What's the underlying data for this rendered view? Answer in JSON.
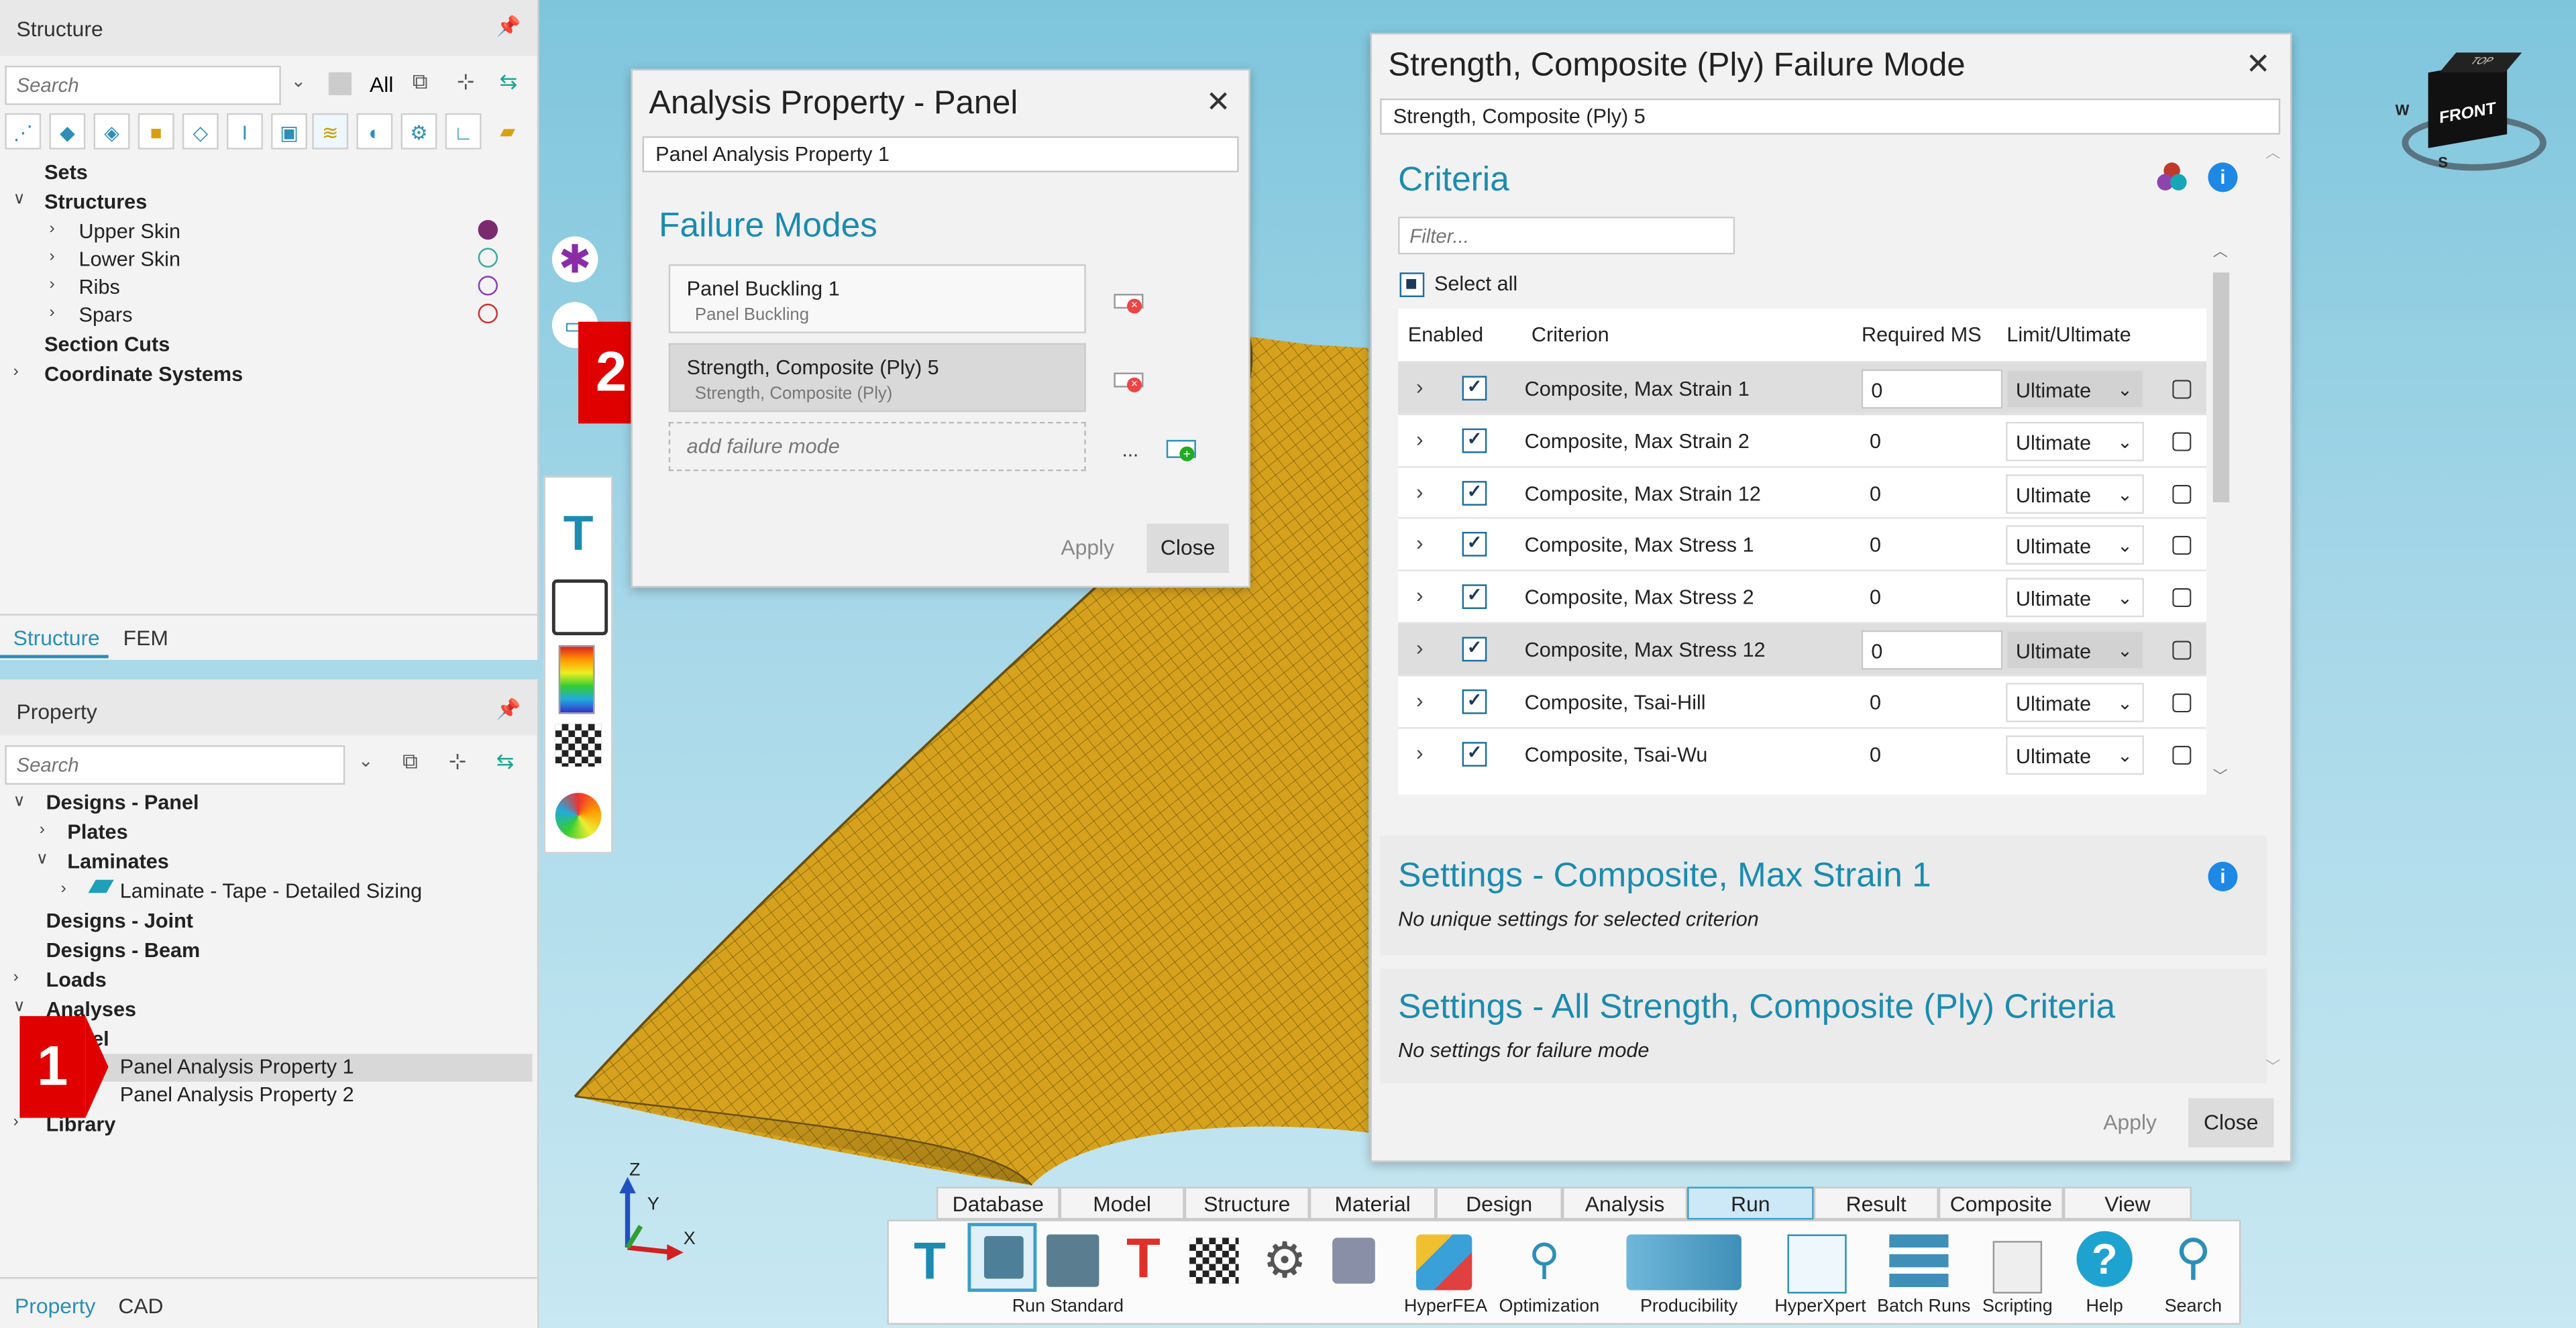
{
  "structure_panel": {
    "title": "Structure",
    "search_placeholder": "Search",
    "filter_label": "All",
    "tree": [
      {
        "label": "Sets"
      },
      {
        "label": "Structures"
      },
      {
        "label": "Upper Skin",
        "color": "#7b2a70"
      },
      {
        "label": "Lower Skin",
        "color": "#3aa9a0"
      },
      {
        "label": "Ribs",
        "color": "#8a3cc0"
      },
      {
        "label": "Spars",
        "color": "#d03030"
      },
      {
        "label": "Section Cuts"
      },
      {
        "label": "Coordinate Systems"
      }
    ],
    "tabs": [
      "Structure",
      "FEM"
    ]
  },
  "property_panel": {
    "title": "Property",
    "search_placeholder": "Search",
    "tree": [
      {
        "label": "Designs - Panel"
      },
      {
        "label": "Plates"
      },
      {
        "label": "Laminates"
      },
      {
        "label": "Laminate - Tape - Detailed Sizing"
      },
      {
        "label": "Designs - Joint"
      },
      {
        "label": "Designs - Beam"
      },
      {
        "label": "Loads"
      },
      {
        "label": "Analyses"
      },
      {
        "label": "el"
      },
      {
        "label": "Panel Analysis Property 1"
      },
      {
        "label": "Panel Analysis Property 2"
      },
      {
        "label": "Library"
      }
    ],
    "tabs": [
      "Property",
      "CAD"
    ]
  },
  "analysis_dialog": {
    "title": "Analysis Property - Panel",
    "name_value": "Panel Analysis Property 1",
    "section_title": "Failure Modes",
    "modes": [
      {
        "name": "Panel Buckling 1",
        "type": "Panel Buckling"
      },
      {
        "name": "Strength, Composite (Ply) 5",
        "type": "Strength, Composite (Ply)"
      }
    ],
    "add_placeholder": "add failure mode",
    "ellipsis": "...",
    "apply": "Apply",
    "close": "Close"
  },
  "failure_dialog": {
    "title": "Strength, Composite (Ply) Failure Mode",
    "name_value": "Strength, Composite (Ply) 5",
    "criteria_title": "Criteria",
    "filter_placeholder": "Filter...",
    "select_all": "Select all",
    "columns": [
      "Enabled",
      "Criterion",
      "Required MS",
      "Limit/Ultimate"
    ],
    "rows": [
      {
        "criterion": "Composite, Max Strain 1",
        "ms": "0",
        "limit": "Ultimate"
      },
      {
        "criterion": "Composite, Max Strain 2",
        "ms": "0",
        "limit": "Ultimate"
      },
      {
        "criterion": "Composite, Max Strain 12",
        "ms": "0",
        "limit": "Ultimate"
      },
      {
        "criterion": "Composite, Max Stress 1",
        "ms": "0",
        "limit": "Ultimate"
      },
      {
        "criterion": "Composite, Max Stress 2",
        "ms": "0",
        "limit": "Ultimate"
      },
      {
        "criterion": "Composite, Max Stress 12",
        "ms": "0",
        "limit": "Ultimate"
      },
      {
        "criterion": "Composite, Tsai-Hill",
        "ms": "0",
        "limit": "Ultimate"
      },
      {
        "criterion": "Composite, Tsai-Wu",
        "ms": "0",
        "limit": "Ultimate"
      }
    ],
    "settings1_title": "Settings - Composite, Max Strain 1",
    "settings1_text": "No unique settings for selected criterion",
    "settings2_title": "Settings - All Strength, Composite (Ply) Criteria",
    "settings2_text": "No settings for failure mode",
    "apply": "Apply",
    "close": "Close"
  },
  "markers": {
    "one": "1",
    "two": "2"
  },
  "viewcube": {
    "top": "TOP",
    "front": "FRONT",
    "w": "W",
    "s": "S"
  },
  "axes": {
    "z": "Z",
    "y": "Y",
    "x": "X"
  },
  "ribbon": {
    "tabs": [
      "Database",
      "Model",
      "Structure",
      "Material",
      "Design",
      "Analysis",
      "Run",
      "Result",
      "Composite",
      "View"
    ],
    "active_tab": "Run",
    "groups": [
      "Run Standard",
      "HyperFEA",
      "Optimization",
      "Producibility",
      "HyperXpert",
      "Batch Runs",
      "Scripting",
      "Help",
      "Search"
    ]
  },
  "colors": {
    "accent": "#1b8bb0",
    "mesh": "#d9a51c",
    "marker": "#e00000"
  }
}
